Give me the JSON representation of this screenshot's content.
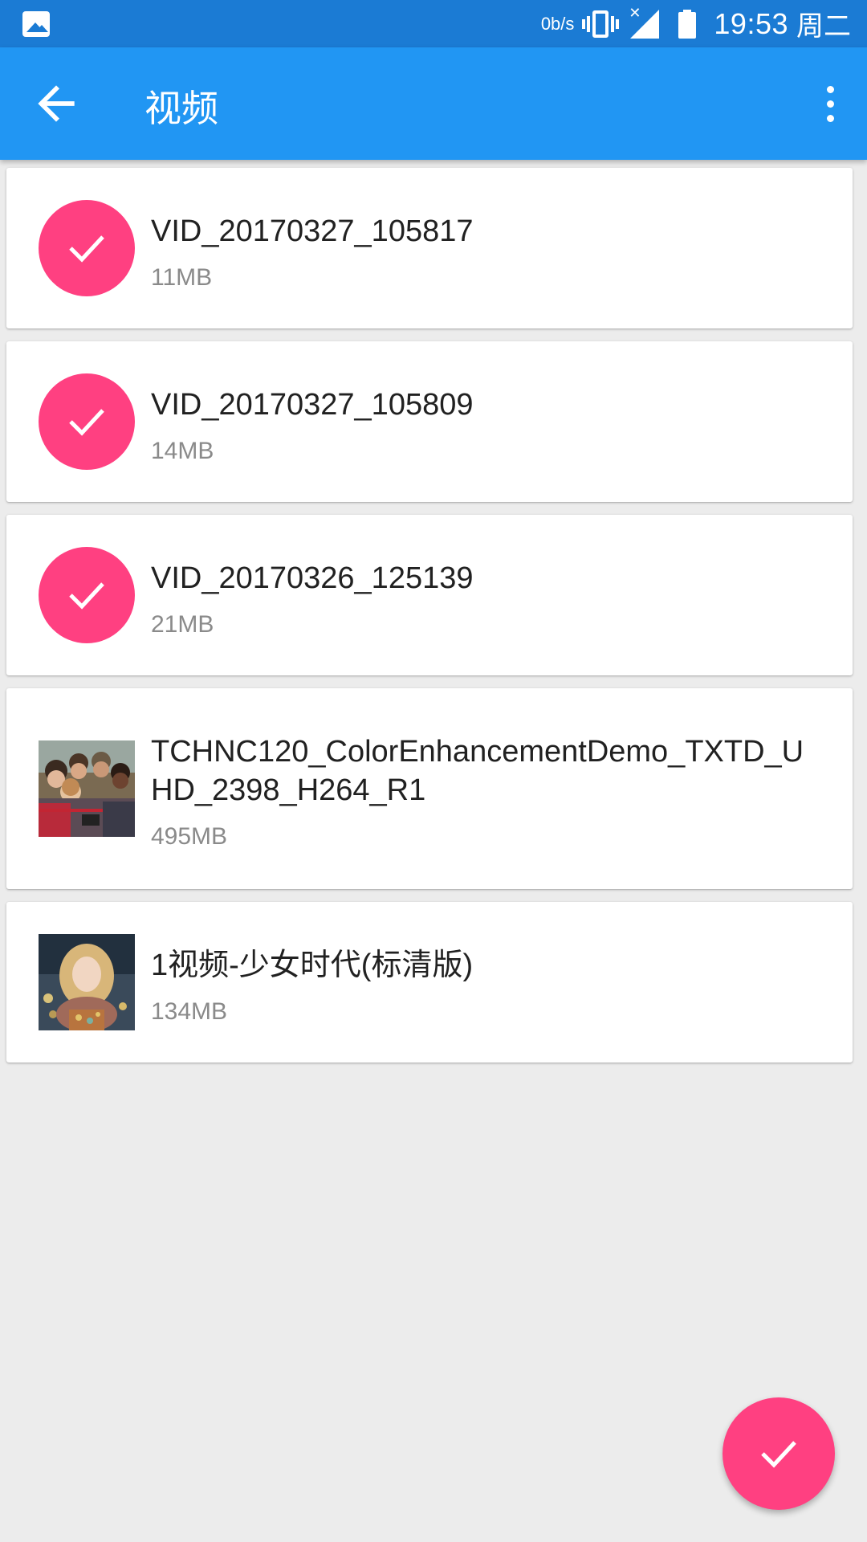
{
  "status_bar": {
    "net_speed": "0b/s",
    "time": "19:53",
    "day": "周二",
    "icons": [
      "gallery-icon",
      "vibrate-icon",
      "signal-icon",
      "battery-icon"
    ]
  },
  "app_bar": {
    "title": "视频",
    "back_icon": "arrow-left-icon",
    "menu_icon": "more-vert-icon"
  },
  "colors": {
    "status_bar": "#1b7bd4",
    "app_bar": "#2196f3",
    "accent": "#ff4081",
    "background": "#ececec"
  },
  "items": [
    {
      "name": "VID_20170327_105817",
      "size": "11MB",
      "selected": true
    },
    {
      "name": "VID_20170327_105809",
      "size": "14MB",
      "selected": true
    },
    {
      "name": "VID_20170326_125139",
      "size": "21MB",
      "selected": true
    },
    {
      "name": "TCHNC120_ColorEnhancementDemo_TXTD_UHD_2398_H264_R1",
      "size": "495MB",
      "selected": false
    },
    {
      "name": "1视频-少女时代(标清版)",
      "size": "134MB",
      "selected": false
    }
  ],
  "fab": {
    "icon": "check-icon"
  }
}
